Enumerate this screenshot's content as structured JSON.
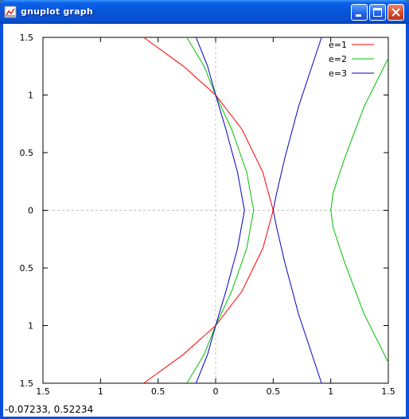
{
  "window": {
    "title": "gnuplot graph",
    "buttons": [
      "minimize",
      "maximize",
      "close"
    ]
  },
  "status": {
    "coordinate_readout": "-0.07233, 0.52234"
  },
  "colors": {
    "e1": "#ff0000",
    "e2": "#00c000",
    "e3": "#0000c0",
    "axes": "#000000",
    "zero_axis": "#c0c0c0"
  },
  "chart_data": {
    "type": "line",
    "xlim": [
      -1.5,
      1.5
    ],
    "ylim": [
      -1.5,
      1.5
    ],
    "x_ticks": [
      -1.5,
      -1,
      -0.5,
      0,
      0.5,
      1,
      1.5
    ],
    "y_ticks": [
      1.5,
      1,
      0.5,
      0,
      -0.5,
      -1,
      -1.5
    ],
    "x_tick_labels": [
      "1.5",
      "1",
      "0.5",
      "0",
      "0.5",
      "1",
      "1.5"
    ],
    "y_tick_labels": [
      "1.5",
      "1",
      "0.5",
      "0",
      "0.5",
      "1",
      "1.5"
    ],
    "zero_axes": true,
    "legend_placement": "top-right",
    "series": [
      {
        "name": "e=1",
        "color": "#ff0000",
        "x": [
          -0.625,
          -0.28,
          0,
          0.23,
          0.41,
          0.5,
          0.41,
          0.23,
          0,
          -0.28,
          -0.625
        ],
        "y": [
          1.5,
          1.25,
          1,
          0.7,
          0.33,
          0,
          -0.33,
          -0.7,
          -1,
          -1.25,
          -1.5
        ]
      },
      {
        "name": "e=2",
        "color": "#00c000",
        "x": [
          -0.25,
          -0.1,
          0,
          0.14,
          0.27,
          0.33,
          0.27,
          0.14,
          0,
          -0.1,
          -0.25
        ],
        "y": [
          1.5,
          1.25,
          1,
          0.7,
          0.33,
          0,
          -0.33,
          -0.7,
          -1,
          -1.25,
          -1.5
        ]
      },
      {
        "name": "e=2",
        "color": "#00c000",
        "x": [
          1.5,
          1.29,
          1.12,
          1.02,
          1.0,
          1.02,
          1.12,
          1.29,
          1.5
        ],
        "y": [
          1.32,
          0.9,
          0.45,
          0.15,
          0,
          -0.15,
          -0.45,
          -0.9,
          -1.32
        ]
      },
      {
        "name": "e=3",
        "color": "#0000c0",
        "x": [
          -0.17,
          -0.07,
          0,
          0.09,
          0.19,
          0.25,
          0.19,
          0.09,
          0,
          -0.07,
          -0.17
        ],
        "y": [
          1.5,
          1.25,
          1,
          0.7,
          0.33,
          0,
          -0.33,
          -0.7,
          -1,
          -1.25,
          -1.5
        ]
      },
      {
        "name": "e=3",
        "color": "#0000c0",
        "x": [
          0.92,
          0.72,
          0.6,
          0.53,
          0.5,
          0.53,
          0.6,
          0.72,
          0.92
        ],
        "y": [
          1.5,
          0.9,
          0.45,
          0.15,
          0,
          -0.15,
          -0.45,
          -0.9,
          -1.5
        ]
      }
    ],
    "legend": [
      {
        "label": "e=1",
        "color": "#ff0000"
      },
      {
        "label": "e=2",
        "color": "#00c000"
      },
      {
        "label": "e=3",
        "color": "#0000c0"
      }
    ]
  }
}
